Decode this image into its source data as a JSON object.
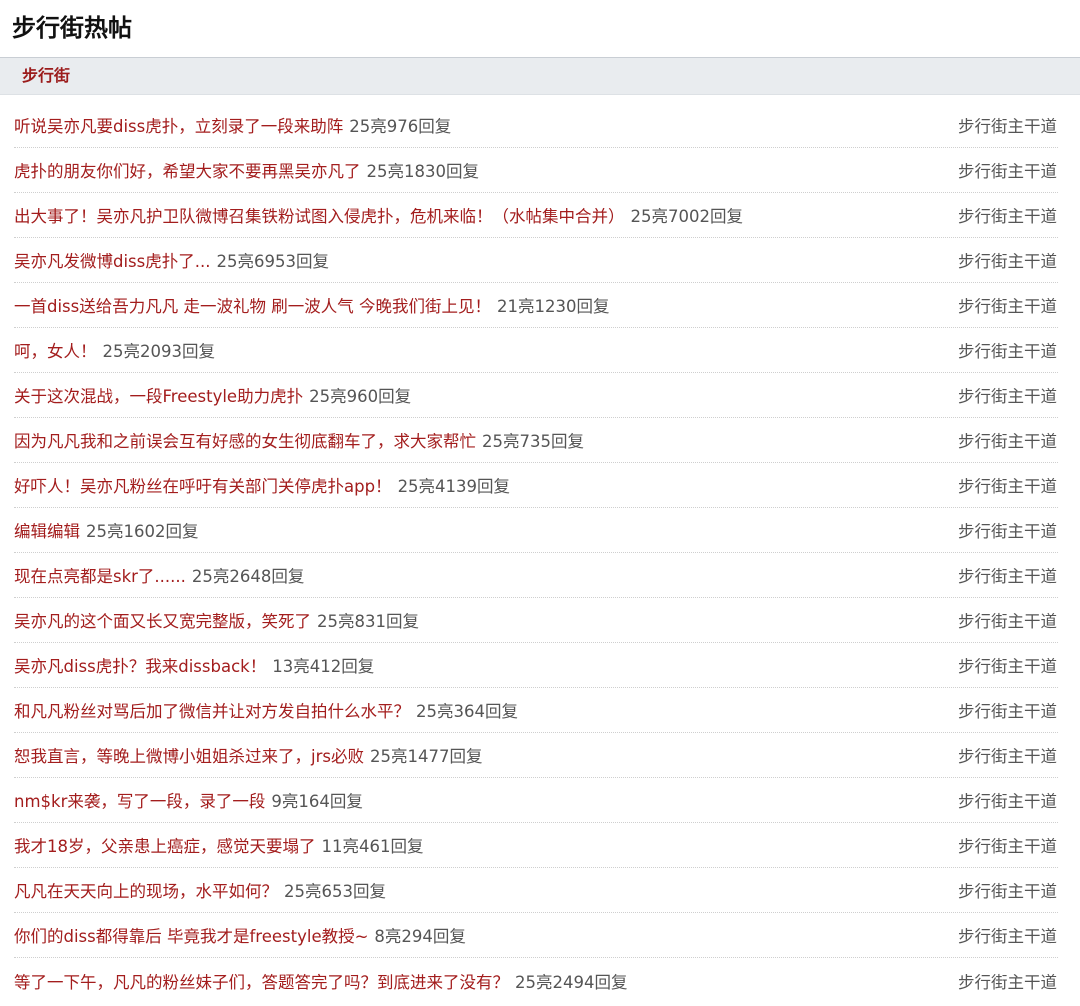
{
  "page": {
    "title": "步行街热帖"
  },
  "section": {
    "label": "步行街"
  },
  "posts": [
    {
      "title": "听说吴亦凡要diss虎扑，立刻录了一段来助阵",
      "meta": "25亮976回复",
      "board": "步行街主干道"
    },
    {
      "title": "虎扑的朋友你们好，希望大家不要再黑吴亦凡了",
      "meta": "25亮1830回复",
      "board": "步行街主干道"
    },
    {
      "title": "出大事了！吴亦凡护卫队微博召集铁粉试图入侵虎扑，危机来临！（水帖集中合并）",
      "meta": "25亮7002回复",
      "board": "步行街主干道"
    },
    {
      "title": "吴亦凡发微博diss虎扑了...",
      "meta": "25亮6953回复",
      "board": "步行街主干道"
    },
    {
      "title": "一首diss送给吾力凡凡 走一波礼物 刷一波人气 今晚我们街上见！",
      "meta": "21亮1230回复",
      "board": "步行街主干道"
    },
    {
      "title": "呵，女人！",
      "meta": "25亮2093回复",
      "board": "步行街主干道"
    },
    {
      "title": "关于这次混战，一段Freestyle助力虎扑",
      "meta": "25亮960回复",
      "board": "步行街主干道"
    },
    {
      "title": "因为凡凡我和之前误会互有好感的女生彻底翻车了，求大家帮忙",
      "meta": "25亮735回复",
      "board": "步行街主干道"
    },
    {
      "title": "好吓人！吴亦凡粉丝在呼吁有关部门关停虎扑app！",
      "meta": "25亮4139回复",
      "board": "步行街主干道"
    },
    {
      "title": "编辑编辑",
      "meta": "25亮1602回复",
      "board": "步行街主干道"
    },
    {
      "title": "现在点亮都是skr了......",
      "meta": "25亮2648回复",
      "board": "步行街主干道"
    },
    {
      "title": "吴亦凡的这个面又长又宽完整版，笑死了",
      "meta": "25亮831回复",
      "board": "步行街主干道"
    },
    {
      "title": "吴亦凡diss虎扑？我来dissback！",
      "meta": "13亮412回复",
      "board": "步行街主干道"
    },
    {
      "title": "和凡凡粉丝对骂后加了微信并让对方发自拍什么水平？",
      "meta": "25亮364回复",
      "board": "步行街主干道"
    },
    {
      "title": "恕我直言，等晚上微博小姐姐杀过来了，jrs必败",
      "meta": "25亮1477回复",
      "board": "步行街主干道"
    },
    {
      "title": "nm$kr来袭，写了一段，录了一段",
      "meta": "9亮164回复",
      "board": "步行街主干道"
    },
    {
      "title": "我才18岁，父亲患上癌症，感觉天要塌了",
      "meta": "11亮461回复",
      "board": "步行街主干道"
    },
    {
      "title": "凡凡在天天向上的现场，水平如何？",
      "meta": "25亮653回复",
      "board": "步行街主干道"
    },
    {
      "title": "你们的diss都得靠后 毕竟我才是freestyle教授~",
      "meta": "8亮294回复",
      "board": "步行街主干道"
    },
    {
      "title": "等了一下午，凡凡的粉丝妹子们，答题答完了吗？到底进来了没有？",
      "meta": "25亮2494回复",
      "board": "步行街主干道"
    }
  ]
}
